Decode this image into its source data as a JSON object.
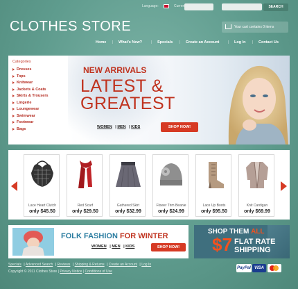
{
  "topbar": {
    "language_label": "Language:",
    "currency_label": "Currencies:",
    "search_placeholder": "",
    "search_button": "SEARCH"
  },
  "header": {
    "logo": "CLOTHES STORE",
    "cart_text": "Your cart contains 0 items"
  },
  "nav": [
    "Home",
    "What's New?",
    "Specials",
    "Create an Account",
    "Log In",
    "Contact Us"
  ],
  "categories": {
    "title": "Categories",
    "items": [
      "Dresses",
      "Tops",
      "Knitwear",
      "Jackets & Coats",
      "Skirts & Trousers",
      "Lingerie",
      "Loungewear",
      "Swimwear",
      "Footwear",
      "Bags"
    ]
  },
  "hero": {
    "line1": "NEW ARRIVALS",
    "line2": "LATEST &",
    "line3": "GREATEST",
    "links": [
      "WOMEN",
      "MEN",
      "KIDS"
    ],
    "link_sep": "|",
    "cta": "SHOP NOW!"
  },
  "products": [
    {
      "name": "Lace Heart Clutch",
      "price": "only $45.50",
      "icon": "clutch-bag-icon"
    },
    {
      "name": "Red Scarf",
      "price": "only $29.50",
      "icon": "scarf-icon"
    },
    {
      "name": "Gathered Skirt",
      "price": "only $32.99",
      "icon": "skirt-icon"
    },
    {
      "name": "Flower Trim Beanie",
      "price": "only $24.99",
      "icon": "beanie-icon"
    },
    {
      "name": "Lace Up Boots",
      "price": "only $95.50",
      "icon": "boot-icon"
    },
    {
      "name": "Knit Cardigan",
      "price": "only $69.99",
      "icon": "cardigan-icon"
    }
  ],
  "promo1": {
    "title_a": "FOLK FASHION",
    "title_b": "FOR WINTER",
    "links": [
      "WOMEN",
      "MEN",
      "KIDS"
    ],
    "link_sep": "|",
    "cta": "SHOP NOW!"
  },
  "promo2": {
    "line1_a": "SHOP THEM",
    "line1_b": "ALL",
    "amount": "$7",
    "line2": "FLAT RATE",
    "line3": "SHIPPING"
  },
  "footer": {
    "links": [
      "Specials",
      "Advanced Search",
      "Reviews",
      "Shipping & Returns",
      "Create an Account",
      "Log In"
    ],
    "sep": "|",
    "copyright": "Copyright © 2011 Clothes Store",
    "privacy": "Privacy Notice",
    "conditions": "Conditions of Use"
  },
  "payments": [
    "PayPal",
    "VISA",
    "MasterCard"
  ],
  "colors": {
    "accent": "#d63a24",
    "background": "#5e9a8c"
  }
}
